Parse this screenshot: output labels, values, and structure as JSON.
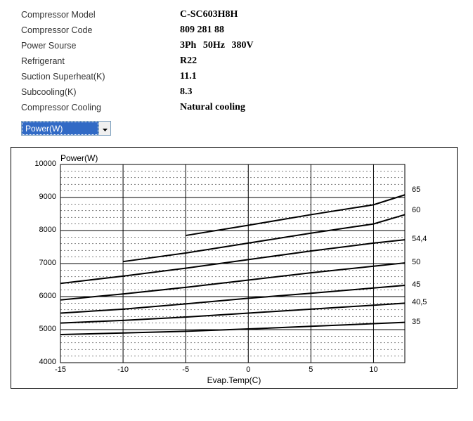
{
  "specs": {
    "model_label": "Compressor Model",
    "model_value": "C-SC603H8H",
    "code_label": "Compressor Code",
    "code_value": "809 281 88",
    "power_source_label": "Power Sourse",
    "power_source_value": "3Ph  50Hz  380V",
    "refrigerant_label": "Refrigerant",
    "refrigerant_value": "R22",
    "superheat_label": "Suction Superheat(K)",
    "superheat_value": "11.1",
    "subcooling_label": "Subcooling(K)",
    "subcooling_value": "8.3",
    "cooling_label": "Compressor Cooling",
    "cooling_value": "Natural cooling"
  },
  "dropdown": {
    "selected": "Power(W)"
  },
  "chart_data": {
    "type": "line",
    "title": "Power(W)",
    "xlabel": "Evap.Temp(C)",
    "ylabel": "",
    "xlim": [
      -15,
      12.5
    ],
    "ylim": [
      4000,
      10000
    ],
    "x_ticks": [
      -15,
      -10,
      -5,
      0,
      5,
      10
    ],
    "y_ticks": [
      4000,
      5000,
      6000,
      7000,
      8000,
      9000,
      10000
    ],
    "x": [
      -15,
      -10,
      -5,
      0,
      5,
      10,
      12.5
    ],
    "series": [
      {
        "name": "35",
        "values": [
          4850,
          4900,
          4950,
          5020,
          5100,
          5180,
          5220
        ],
        "x_start": -15
      },
      {
        "name": "40,5",
        "values": [
          5200,
          5280,
          5380,
          5500,
          5620,
          5740,
          5800
        ],
        "x_start": -15
      },
      {
        "name": "45",
        "values": [
          5500,
          5620,
          5780,
          5950,
          6100,
          6260,
          6340
        ],
        "x_start": -15
      },
      {
        "name": "50",
        "values": [
          5900,
          6080,
          6280,
          6500,
          6720,
          6920,
          7020
        ],
        "x_start": -15
      },
      {
        "name": "54,4",
        "values": [
          6400,
          6620,
          6860,
          7120,
          7380,
          7620,
          7720
        ],
        "x_start": -15
      },
      {
        "name": "60",
        "values": [
          7060,
          7320,
          7620,
          7920,
          8200,
          8480,
          8600
        ],
        "x_start": -10
      },
      {
        "name": "65",
        "values": [
          7850,
          8160,
          8480,
          8780,
          9080,
          9220
        ],
        "x_start": -5
      }
    ],
    "right_labels": [
      "65",
      "60",
      "54,4",
      "50",
      "45",
      "40,5",
      "35"
    ]
  }
}
